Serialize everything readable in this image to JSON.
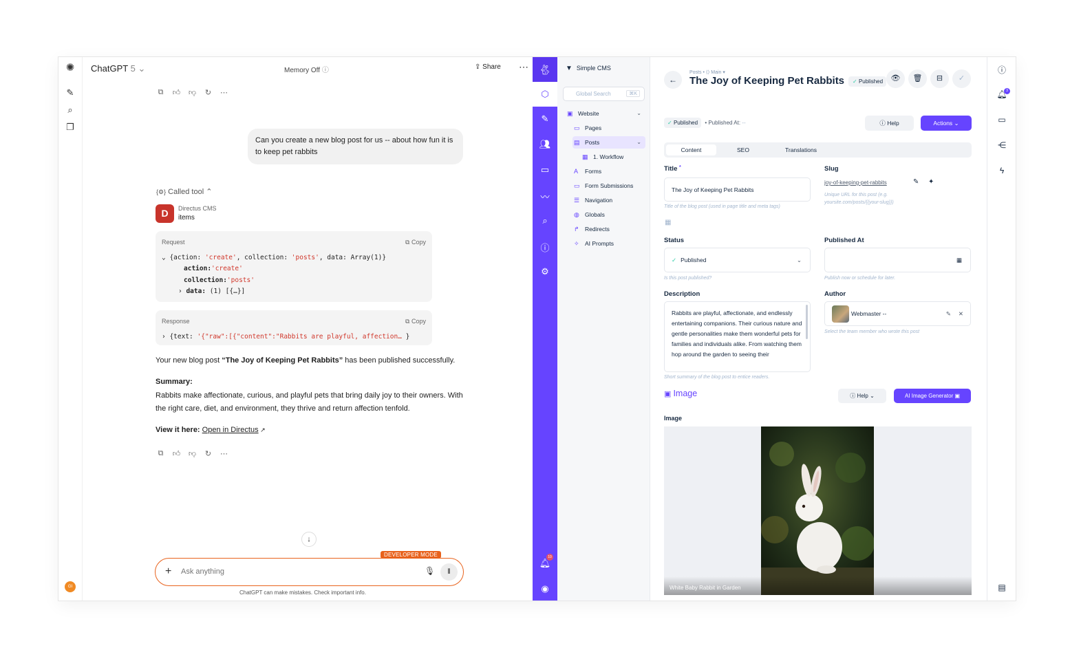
{
  "chatgpt": {
    "title": "ChatGPT",
    "version": "5",
    "memory": "Memory Off",
    "share": "Share",
    "user_message": "Can you create a new blog post for us -- about how fun it is to keep pet rabbits",
    "called_tool": "Called tool",
    "tool_source": "Directus CMS",
    "tool_name": "items",
    "badge_letter": "D",
    "request": {
      "label": "Request",
      "copy": "Copy",
      "line1_pre": "{action: ",
      "line1_action": "'create'",
      "line1_mid": ", collection: ",
      "line1_collection": "'posts'",
      "line1_post": ", data: Array(1)}",
      "action_key": "action:",
      "action_val": "'create'",
      "collection_key": "collection:",
      "collection_val": "'posts'",
      "data_key": "data:",
      "data_val": "(1) [{…}]"
    },
    "response": {
      "label": "Response",
      "copy": "Copy",
      "pre": "{text: ",
      "val": "'{\"raw\":[{\"content\":\"Rabbits are playful, affection…",
      "post": " }"
    },
    "result_pre": "Your new blog post ",
    "result_title": "“The Joy of Keeping Pet Rabbits”",
    "result_post": " has been published successfully.",
    "summary_label": "Summary:",
    "summary_text": "Rabbits make affectionate, curious, and playful pets that bring daily joy to their owners. With the right care, diet, and environment, they thrive and return affection tenfold.",
    "view_label": "View it here:",
    "view_link": "Open in Directus",
    "developer_mode": "DEVELOPER MODE",
    "composer_placeholder": "Ask anything",
    "disclaimer": "ChatGPT can make mistakes. Check important info.",
    "user_initials": "GI"
  },
  "directus": {
    "project": "Simple CMS",
    "search_placeholder": "Global Search",
    "search_kbd": "⌘K",
    "bell_count": "10",
    "nav": [
      {
        "label": "Website"
      },
      {
        "label": "Pages"
      },
      {
        "label": "Posts"
      },
      {
        "label": "1. Workflow"
      },
      {
        "label": "Forms"
      },
      {
        "label": "Form Submissions"
      },
      {
        "label": "Navigation"
      },
      {
        "label": "Globals"
      },
      {
        "label": "Redirects"
      },
      {
        "label": "AI Prompts"
      }
    ],
    "breadcrumb": "Posts • ⟨⟩ Main ▾",
    "page_title": "The Joy of Keeping Pet Rabbits –",
    "title_status": "Published",
    "status_pill": "Published",
    "published_at_label": "• Published At:",
    "published_at_value": "--",
    "help": "Help",
    "actions": "Actions",
    "tabs": [
      "Content",
      "SEO",
      "Translations"
    ],
    "fields": {
      "title_label": "Title",
      "title_required": "*",
      "title_value": "The Joy of Keeping Pet Rabbits",
      "title_hint": "Title of the blog post (used in page title and meta tags)",
      "slug_label": "Slug",
      "slug_value": "joy-of-keeping-pet-rabbits",
      "slug_hint": "Unique URL for this post (e.g. yoursite.com/posts/{{your-slug}})",
      "status_label": "Status",
      "status_value": "Published",
      "status_hint": "Is this post published?",
      "published_at_label": "Published At",
      "published_at_hint": "Publish now or schedule for later.",
      "description_label": "Description",
      "description_value": "Rabbits are playful, affectionate, and endlessly entertaining companions. Their curious nature and gentle personalities make them wonderful pets for families and individuals alike. From watching them hop around the garden to seeing their",
      "description_hint": "Short summary of the blog post to entice readers.",
      "author_label": "Author",
      "author_value": "Webmaster --",
      "author_hint": "Select the team member who wrote this post",
      "image_section": "Image",
      "image_label": "Image",
      "image_help": "Help",
      "ai_generator": "AI Image Generator",
      "image_caption": "White Baby Rabbit in Garden"
    },
    "right_badge": "3"
  },
  "colors": {
    "directus_accent": "#6644ff",
    "chatgpt_dev_orange": "#e8621c",
    "badge_red": "#c8342b",
    "success_green": "#2ecda7"
  },
  "icons": [
    "openai-logo-icon",
    "new-chat-icon",
    "search-icon",
    "library-icon",
    "copy-icon",
    "thumbs-up-icon",
    "thumbs-down-icon",
    "regenerate-icon",
    "more-icon",
    "share-icon",
    "info-icon",
    "mic-icon",
    "voice-icon",
    "plus-icon",
    "arrow-down-icon",
    "rabbit-logo-icon",
    "cube-icon",
    "edit-icon",
    "users-icon",
    "folder-icon",
    "insights-icon",
    "help-icon",
    "settings-icon",
    "bell-icon",
    "account-icon",
    "back-arrow-icon",
    "eye-icon",
    "trash-icon",
    "archive-icon",
    "check-icon",
    "calendar-icon",
    "pencil-icon",
    "magic-wand-icon",
    "close-icon",
    "image-icon",
    "comment-icon",
    "flash-icon",
    "clipboard-icon"
  ]
}
